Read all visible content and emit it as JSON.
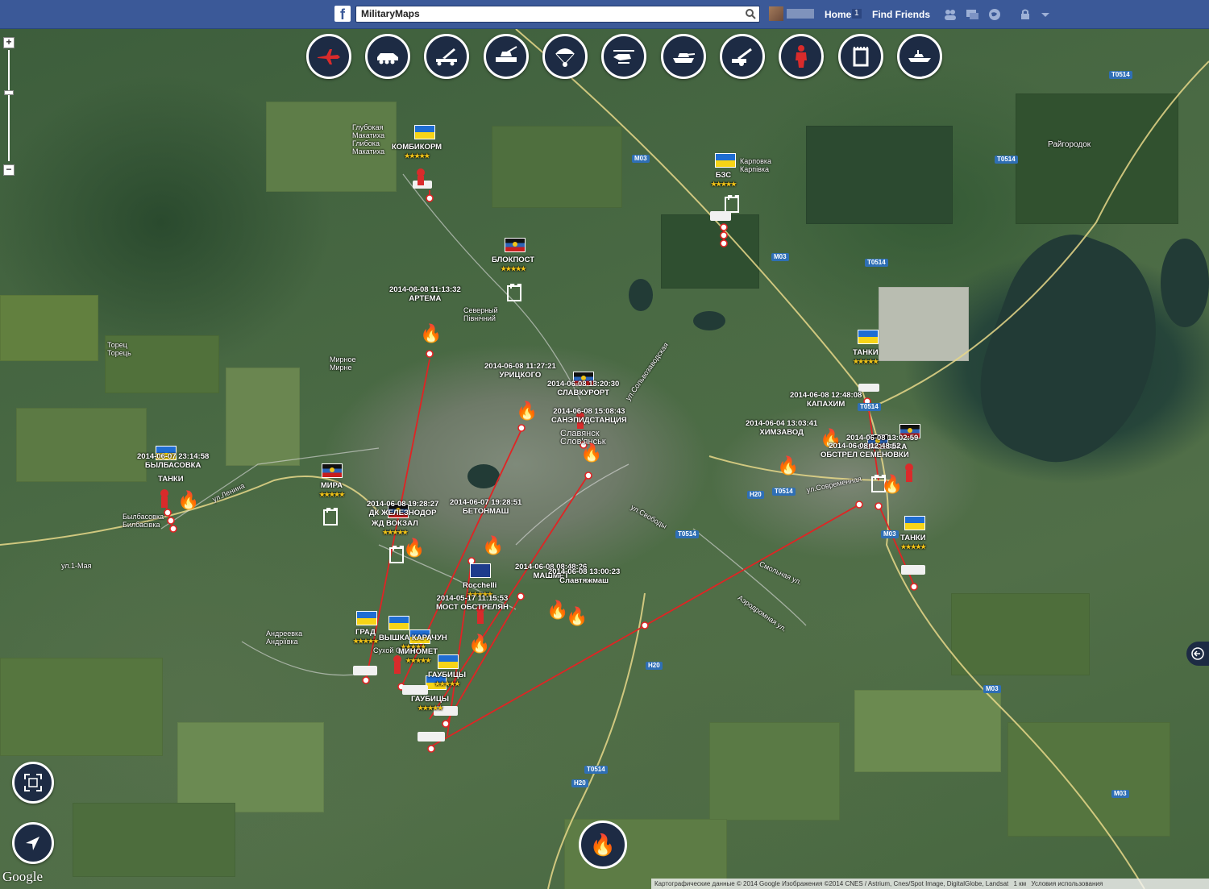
{
  "fb": {
    "search_value": "MilitaryMaps",
    "home_label": "Home",
    "home_count": "1",
    "find_friends_label": "Find Friends"
  },
  "toolbar": {
    "units": [
      {
        "icon": "jet-icon"
      },
      {
        "icon": "apc-icon"
      },
      {
        "icon": "missile-launcher-icon"
      },
      {
        "icon": "self-propelled-artillery-icon"
      },
      {
        "icon": "paratrooper-icon"
      },
      {
        "icon": "helicopter-icon"
      },
      {
        "icon": "tank-icon"
      },
      {
        "icon": "howitzer-icon"
      },
      {
        "icon": "soldier-icon"
      },
      {
        "icon": "checkpoint-icon"
      },
      {
        "icon": "ship-icon"
      }
    ]
  },
  "colors": {
    "button_bg": "#1d2b44",
    "route": "#e02424",
    "ua_blue": "#1f6dd2",
    "ua_yellow": "#f7d417",
    "road_badge": "#2f6fb5"
  },
  "map": {
    "places": [
      {
        "name": "Глубокая\nМакатиха\nГлибока\nМакатиха"
      },
      {
        "name": "Карповка\nКарпівка"
      },
      {
        "name": "Райгородок"
      },
      {
        "name": "Торец\nТорець"
      },
      {
        "name": "Мирное\nМирне"
      },
      {
        "name": "Северный\nПівнічний"
      },
      {
        "name": "Былбасовка\nБилбасівка"
      },
      {
        "name": "Андреевка\nАндріївка"
      },
      {
        "name": "Сухой\nСухий"
      },
      {
        "name": "Славянск\nСлов'янськ"
      },
      {
        "name": "ул.1-Мая"
      },
      {
        "name": "ул.Ленина"
      },
      {
        "name": "ул.Свободы"
      },
      {
        "name": "Смольная ул."
      },
      {
        "name": "Аэродромная ул."
      },
      {
        "name": "ул.Современная"
      },
      {
        "name": "ул.Сольвозаводская"
      }
    ],
    "roads": [
      "M03",
      "M03",
      "M03",
      "M03",
      "T0514",
      "T0514",
      "T0514",
      "T0514",
      "T0514",
      "T0514",
      "H20",
      "H20",
      "H20",
      "T0514",
      "M03"
    ],
    "markers": [
      {
        "title": "КОМБИКОРМ"
      },
      {
        "title": "БЛОКПОСТ"
      },
      {
        "title": "БЗС"
      },
      {
        "title": "2014-06-08 11:13:32\nАРТЕМА"
      },
      {
        "title": "2014-06-08 11:27:21\nУРИЦКОГО"
      },
      {
        "title": "2014-06-08 13:20:30\nСЛАВКУРОРТ"
      },
      {
        "title": "2014-06-08 15:08:43\nСАНЭПИДСТАНЦИЯ"
      },
      {
        "title": "ТАНКИ"
      },
      {
        "title": "2014-06-08 12:48:08\nКАПАХИМ"
      },
      {
        "title": "2014-06-04 13:03:41\nХИМЗАВОД"
      },
      {
        "title": "2014-06-08 13:02:59\nСЕМЕНОВКА"
      },
      {
        "title": "2014-06-08 12:48:52\nОБСТРЕЛ СЕМЕНОВКИ"
      },
      {
        "title": "ТАНКИ"
      },
      {
        "title": "2014-06-07 23:14:58\nБЫЛБАСОВКА"
      },
      {
        "title": "ТАНКИ"
      },
      {
        "title": "МИРА"
      },
      {
        "title": "2014-06-08 19:28:27\nДК ЖЕЛЕЗНОДОР"
      },
      {
        "title": "ЖД ВОКЗАЛ"
      },
      {
        "title": "2014-06-07 19:28:51\nБЕТОНМАШ"
      },
      {
        "title": "Rocchelli"
      },
      {
        "title": "2014-06-08 08:48:26\nМАШМЕТ"
      },
      {
        "title": "2014-06-08 13:00:23\nСлавтяжмаш"
      },
      {
        "title": "2014-05-17 11:15:53\nМОСТ ОБСТРЕЛЯН"
      },
      {
        "title": "ГРАД"
      },
      {
        "title": "ВЫШКА КАРАЧУН"
      },
      {
        "title": "МИНОМЕТ"
      },
      {
        "title": "ГАУБИЦЫ"
      },
      {
        "title": "ГАУБИЦЫ"
      }
    ],
    "stars": "★★★★★"
  },
  "attribution": {
    "text": "Картографические данные © 2014 Google Изображения ©2014 CNES / Astrium, Cnes/Spot Image, DigitalGlobe, Landsat",
    "scale": "1 км",
    "terms": "Условия использования"
  },
  "google_logo": "Google"
}
